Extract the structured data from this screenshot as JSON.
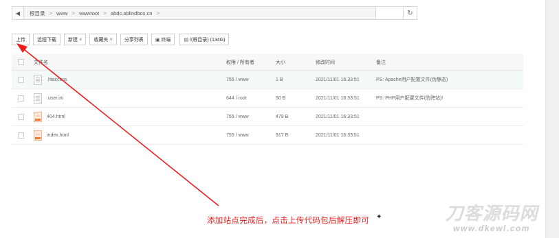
{
  "address_bar": {
    "back_icon": "arrow-left-icon",
    "crumbs": [
      "根目录",
      "www",
      "wwwroot",
      "abdc.ablindbox.cn"
    ],
    "separator": ">",
    "refresh_icon": "refresh-icon"
  },
  "toolbar": {
    "upload": "上传",
    "remote_download": "远程下载",
    "new": "新建",
    "favorites": "收藏夹",
    "share_list": "分享列表",
    "terminal": "终端",
    "disk": "/(根目录) (134G)"
  },
  "table": {
    "headers": {
      "name": "文件名",
      "permission": "权限 / 所有者",
      "size": "大小",
      "modified": "修改时间",
      "note": "备注"
    },
    "rows": [
      {
        "name": ".htaccess",
        "icon": "file-text-icon",
        "permission": "755 / www",
        "size": "1 B",
        "modified": "2021/11/01 16:33:51",
        "note": "PS: Apache用户配置文件(伪静态)"
      },
      {
        "name": ".user.ini",
        "icon": "file-text-icon",
        "permission": "644 / root",
        "size": "50 B",
        "modified": "2021/11/01 16:33:51",
        "note": "PS: PHP用户配置文件(防跨站)!"
      },
      {
        "name": "404.html",
        "icon": "html-file-icon",
        "permission": "755 / www",
        "size": "479 B",
        "modified": "2021/11/01 16:33:51",
        "note": ""
      },
      {
        "name": "index.html",
        "icon": "html-file-icon",
        "permission": "755 / www",
        "size": "917 B",
        "modified": "2021/11/01 16:33:51",
        "note": ""
      }
    ]
  },
  "annotation": {
    "text": "添加站点完成后，点击上传代码包后解压即可",
    "color": "#f01c1c"
  },
  "watermark": {
    "title": "刀客源码网",
    "url": "www.dkewl.com"
  }
}
